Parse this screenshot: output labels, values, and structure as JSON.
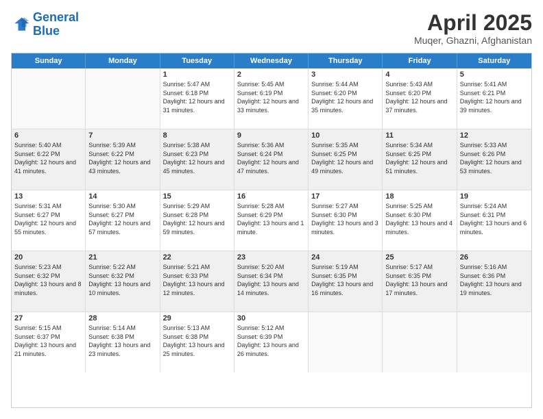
{
  "logo": {
    "line1": "General",
    "line2": "Blue"
  },
  "title": "April 2025",
  "subtitle": "Muqer, Ghazni, Afghanistan",
  "days": [
    "Sunday",
    "Monday",
    "Tuesday",
    "Wednesday",
    "Thursday",
    "Friday",
    "Saturday"
  ],
  "weeks": [
    [
      {
        "date": "",
        "sunrise": "",
        "sunset": "",
        "daylight": ""
      },
      {
        "date": "",
        "sunrise": "",
        "sunset": "",
        "daylight": ""
      },
      {
        "date": "1",
        "sunrise": "Sunrise: 5:47 AM",
        "sunset": "Sunset: 6:18 PM",
        "daylight": "Daylight: 12 hours and 31 minutes."
      },
      {
        "date": "2",
        "sunrise": "Sunrise: 5:45 AM",
        "sunset": "Sunset: 6:19 PM",
        "daylight": "Daylight: 12 hours and 33 minutes."
      },
      {
        "date": "3",
        "sunrise": "Sunrise: 5:44 AM",
        "sunset": "Sunset: 6:20 PM",
        "daylight": "Daylight: 12 hours and 35 minutes."
      },
      {
        "date": "4",
        "sunrise": "Sunrise: 5:43 AM",
        "sunset": "Sunset: 6:20 PM",
        "daylight": "Daylight: 12 hours and 37 minutes."
      },
      {
        "date": "5",
        "sunrise": "Sunrise: 5:41 AM",
        "sunset": "Sunset: 6:21 PM",
        "daylight": "Daylight: 12 hours and 39 minutes."
      }
    ],
    [
      {
        "date": "6",
        "sunrise": "Sunrise: 5:40 AM",
        "sunset": "Sunset: 6:22 PM",
        "daylight": "Daylight: 12 hours and 41 minutes."
      },
      {
        "date": "7",
        "sunrise": "Sunrise: 5:39 AM",
        "sunset": "Sunset: 6:22 PM",
        "daylight": "Daylight: 12 hours and 43 minutes."
      },
      {
        "date": "8",
        "sunrise": "Sunrise: 5:38 AM",
        "sunset": "Sunset: 6:23 PM",
        "daylight": "Daylight: 12 hours and 45 minutes."
      },
      {
        "date": "9",
        "sunrise": "Sunrise: 5:36 AM",
        "sunset": "Sunset: 6:24 PM",
        "daylight": "Daylight: 12 hours and 47 minutes."
      },
      {
        "date": "10",
        "sunrise": "Sunrise: 5:35 AM",
        "sunset": "Sunset: 6:25 PM",
        "daylight": "Daylight: 12 hours and 49 minutes."
      },
      {
        "date": "11",
        "sunrise": "Sunrise: 5:34 AM",
        "sunset": "Sunset: 6:25 PM",
        "daylight": "Daylight: 12 hours and 51 minutes."
      },
      {
        "date": "12",
        "sunrise": "Sunrise: 5:33 AM",
        "sunset": "Sunset: 6:26 PM",
        "daylight": "Daylight: 12 hours and 53 minutes."
      }
    ],
    [
      {
        "date": "13",
        "sunrise": "Sunrise: 5:31 AM",
        "sunset": "Sunset: 6:27 PM",
        "daylight": "Daylight: 12 hours and 55 minutes."
      },
      {
        "date": "14",
        "sunrise": "Sunrise: 5:30 AM",
        "sunset": "Sunset: 6:27 PM",
        "daylight": "Daylight: 12 hours and 57 minutes."
      },
      {
        "date": "15",
        "sunrise": "Sunrise: 5:29 AM",
        "sunset": "Sunset: 6:28 PM",
        "daylight": "Daylight: 12 hours and 59 minutes."
      },
      {
        "date": "16",
        "sunrise": "Sunrise: 5:28 AM",
        "sunset": "Sunset: 6:29 PM",
        "daylight": "Daylight: 13 hours and 1 minute."
      },
      {
        "date": "17",
        "sunrise": "Sunrise: 5:27 AM",
        "sunset": "Sunset: 6:30 PM",
        "daylight": "Daylight: 13 hours and 3 minutes."
      },
      {
        "date": "18",
        "sunrise": "Sunrise: 5:25 AM",
        "sunset": "Sunset: 6:30 PM",
        "daylight": "Daylight: 13 hours and 4 minutes."
      },
      {
        "date": "19",
        "sunrise": "Sunrise: 5:24 AM",
        "sunset": "Sunset: 6:31 PM",
        "daylight": "Daylight: 13 hours and 6 minutes."
      }
    ],
    [
      {
        "date": "20",
        "sunrise": "Sunrise: 5:23 AM",
        "sunset": "Sunset: 6:32 PM",
        "daylight": "Daylight: 13 hours and 8 minutes."
      },
      {
        "date": "21",
        "sunrise": "Sunrise: 5:22 AM",
        "sunset": "Sunset: 6:32 PM",
        "daylight": "Daylight: 13 hours and 10 minutes."
      },
      {
        "date": "22",
        "sunrise": "Sunrise: 5:21 AM",
        "sunset": "Sunset: 6:33 PM",
        "daylight": "Daylight: 13 hours and 12 minutes."
      },
      {
        "date": "23",
        "sunrise": "Sunrise: 5:20 AM",
        "sunset": "Sunset: 6:34 PM",
        "daylight": "Daylight: 13 hours and 14 minutes."
      },
      {
        "date": "24",
        "sunrise": "Sunrise: 5:19 AM",
        "sunset": "Sunset: 6:35 PM",
        "daylight": "Daylight: 13 hours and 16 minutes."
      },
      {
        "date": "25",
        "sunrise": "Sunrise: 5:17 AM",
        "sunset": "Sunset: 6:35 PM",
        "daylight": "Daylight: 13 hours and 17 minutes."
      },
      {
        "date": "26",
        "sunrise": "Sunrise: 5:16 AM",
        "sunset": "Sunset: 6:36 PM",
        "daylight": "Daylight: 13 hours and 19 minutes."
      }
    ],
    [
      {
        "date": "27",
        "sunrise": "Sunrise: 5:15 AM",
        "sunset": "Sunset: 6:37 PM",
        "daylight": "Daylight: 13 hours and 21 minutes."
      },
      {
        "date": "28",
        "sunrise": "Sunrise: 5:14 AM",
        "sunset": "Sunset: 6:38 PM",
        "daylight": "Daylight: 13 hours and 23 minutes."
      },
      {
        "date": "29",
        "sunrise": "Sunrise: 5:13 AM",
        "sunset": "Sunset: 6:38 PM",
        "daylight": "Daylight: 13 hours and 25 minutes."
      },
      {
        "date": "30",
        "sunrise": "Sunrise: 5:12 AM",
        "sunset": "Sunset: 6:39 PM",
        "daylight": "Daylight: 13 hours and 26 minutes."
      },
      {
        "date": "",
        "sunrise": "",
        "sunset": "",
        "daylight": ""
      },
      {
        "date": "",
        "sunrise": "",
        "sunset": "",
        "daylight": ""
      },
      {
        "date": "",
        "sunrise": "",
        "sunset": "",
        "daylight": ""
      }
    ]
  ]
}
